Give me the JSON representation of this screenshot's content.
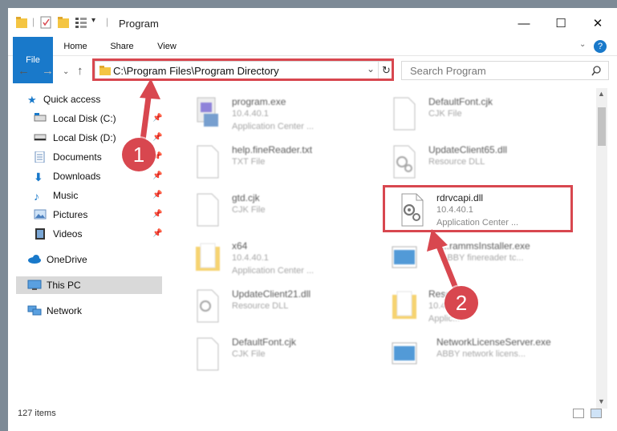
{
  "titlebar": {
    "title": "Program",
    "buttons": {
      "minimize": "—",
      "maximize": "☐",
      "close": "✕"
    }
  },
  "ribbon": {
    "tabs": [
      "File",
      "Home",
      "Share",
      "View"
    ],
    "help": "?"
  },
  "address": {
    "path": "C:\\Program Files\\Program Directory",
    "search_placeholder": "Search Program"
  },
  "nav": {
    "quick_access": "Quick access",
    "items": [
      "Local Disk (C:)",
      "Local Disk (D:)",
      "Documents",
      "Downloads",
      "Music",
      "Pictures",
      "Videos"
    ],
    "onedrive": "OneDrive",
    "thispc": "This PC",
    "network": "Network"
  },
  "files": [
    {
      "name": "program.exe",
      "sub1": "10.4.40.1",
      "sub2": "Application Center ..."
    },
    {
      "name": "DefaultFont.cjk",
      "sub1": "CJK File",
      "sub2": ""
    },
    {
      "name": "help.fineReader.txt",
      "sub1": "TXT File",
      "sub2": ""
    },
    {
      "name": "UpdateClient65.dll",
      "sub1": "Resource DLL",
      "sub2": ""
    },
    {
      "name": "gtd.cjk",
      "sub1": "CJK File",
      "sub2": ""
    },
    {
      "name": "rdrvcapi.dll",
      "sub1": "10.4.40.1",
      "sub2": "Application Center ..."
    },
    {
      "name": "x64",
      "sub1": "10.4.40.1",
      "sub2": "Application Center ..."
    },
    {
      "name": "...rammsInstaller.exe",
      "sub1": "ABBY finereader tc...",
      "sub2": ""
    },
    {
      "name": "UpdateClient21.dll",
      "sub1": "Resource DLL",
      "sub2": ""
    },
    {
      "name": "Resou...",
      "sub1": "10.4...",
      "sub2": "Applic..."
    },
    {
      "name": "DefaultFont.cjk",
      "sub1": "CJK File",
      "sub2": ""
    },
    {
      "name": "NetworkLicenseServer.exe",
      "sub1": "ABBY network licens...",
      "sub2": ""
    }
  ],
  "status": {
    "count": "127 items"
  },
  "annotations": [
    "1",
    "2"
  ],
  "colors": {
    "accent": "#1979ca",
    "highlight": "#d8474f"
  }
}
